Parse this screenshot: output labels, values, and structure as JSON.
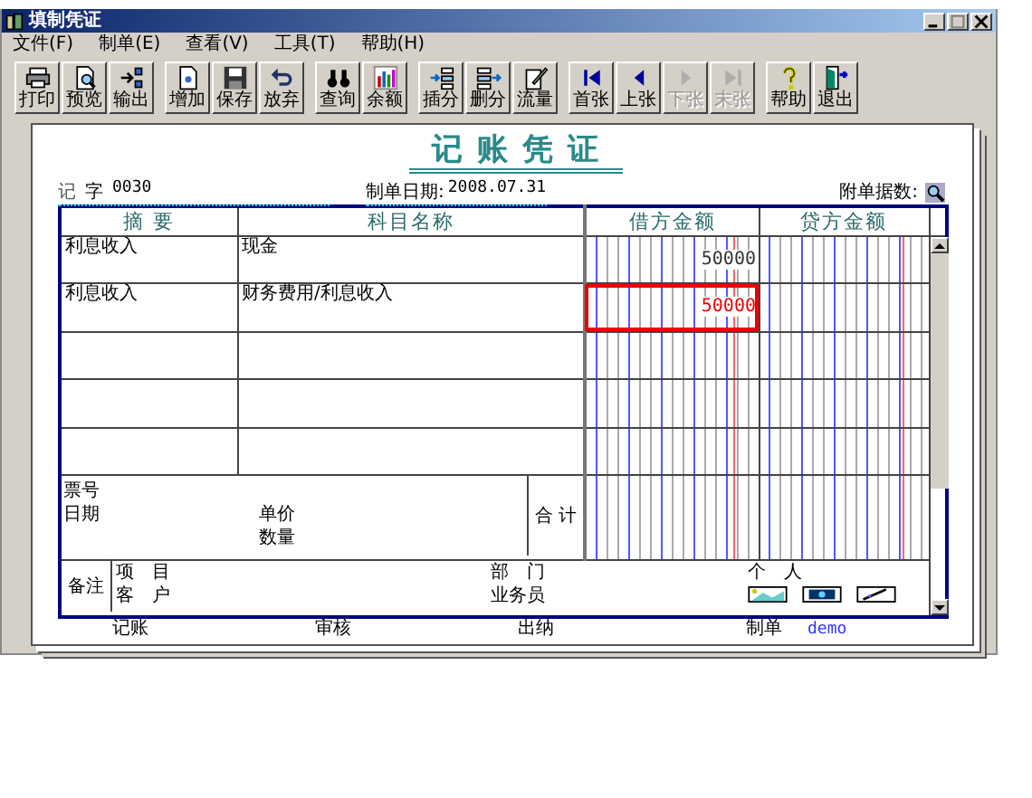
{
  "window": {
    "title": "填制凭证"
  },
  "menu": [
    "文件(F)",
    "制单(E)",
    "查看(V)",
    "工具(T)",
    "帮助(H)"
  ],
  "toolbar": [
    {
      "buttons": [
        {
          "label": "打印",
          "disabled": false
        },
        {
          "label": "预览",
          "disabled": false
        },
        {
          "label": "输出",
          "disabled": false
        }
      ]
    },
    {
      "buttons": [
        {
          "label": "增加",
          "disabled": false
        },
        {
          "label": "保存",
          "disabled": false
        },
        {
          "label": "放弃",
          "disabled": false
        }
      ]
    },
    {
      "buttons": [
        {
          "label": "查询",
          "disabled": false
        },
        {
          "label": "余额",
          "disabled": false
        }
      ]
    },
    {
      "buttons": [
        {
          "label": "插分",
          "disabled": false
        },
        {
          "label": "删分",
          "disabled": false
        },
        {
          "label": "流量",
          "disabled": false
        }
      ]
    },
    {
      "buttons": [
        {
          "label": "首张",
          "disabled": false
        },
        {
          "label": "上张",
          "disabled": false
        },
        {
          "label": "下张",
          "disabled": true
        },
        {
          "label": "末张",
          "disabled": true
        }
      ]
    },
    {
      "buttons": [
        {
          "label": "帮助",
          "disabled": false
        },
        {
          "label": "退出",
          "disabled": false
        }
      ]
    }
  ],
  "voucher": {
    "title": "记账凭证",
    "type": "记",
    "type_suffix": "字",
    "number": "0030",
    "date_label": "制单日期:",
    "date": "2008.07.31",
    "attachments_label": "附单据数:",
    "columns": [
      "摘 要",
      "科目名称",
      "借方金额",
      "贷方金额"
    ],
    "rows": [
      {
        "summary": "利息收入",
        "account": "现金",
        "debit": "50000",
        "selected": false
      },
      {
        "summary": "利息收入",
        "account": "财务费用/利息收入",
        "debit": "50000",
        "selected": true
      },
      {
        "summary": "",
        "account": "",
        "debit": "",
        "selected": false
      },
      {
        "summary": "",
        "account": "",
        "debit": "",
        "selected": false
      },
      {
        "summary": "",
        "account": "",
        "debit": "",
        "selected": false
      }
    ],
    "totals": {
      "ticket_label": "票号",
      "date_label": "日期",
      "price_label": "单价",
      "quantity_label": "数量",
      "total_label": "合 计"
    },
    "remarks": {
      "label": "备注",
      "project_label": "项　目",
      "customer_label": "客　户",
      "department_label": "部　门",
      "salesperson_label": "业务员",
      "person_label": "个　人"
    },
    "signatures": [
      {
        "label": "记账"
      },
      {
        "label": "审核"
      },
      {
        "label": "出纳"
      },
      {
        "label": "制单",
        "value": "demo"
      }
    ]
  }
}
